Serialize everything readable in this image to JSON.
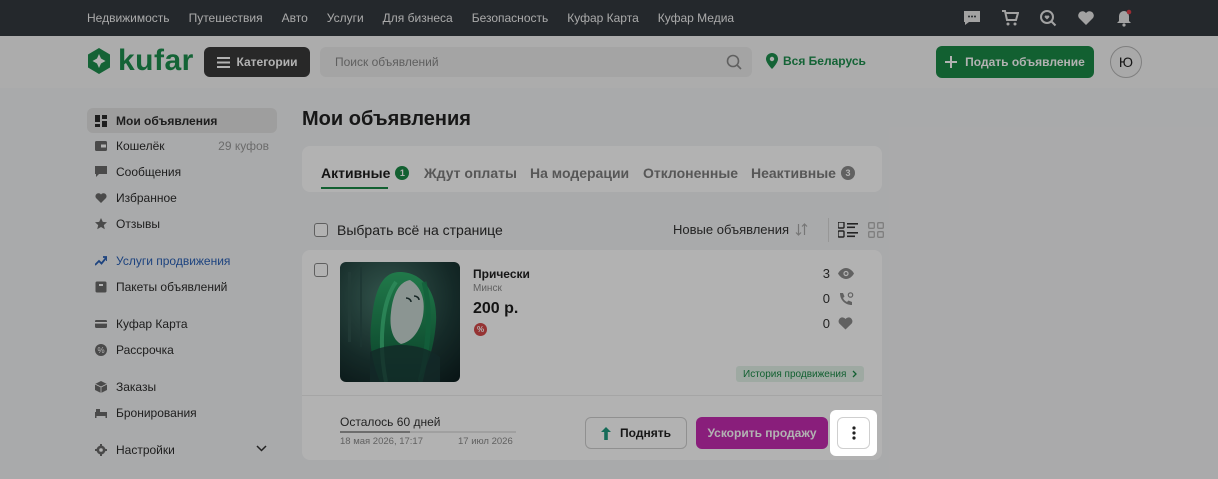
{
  "topnav": {
    "links": [
      "Недвижимость",
      "Путешествия",
      "Авто",
      "Услуги",
      "Для бизнеса",
      "Безопасность",
      "Куфар Карта",
      "Куфар Медиа"
    ],
    "icons": [
      "chat-icon",
      "cart-icon",
      "search-heart-icon",
      "heart-icon",
      "bell-icon"
    ]
  },
  "header": {
    "logo_text": "kufar",
    "categories_label": "Категории",
    "search_placeholder": "Поиск объявлений",
    "region_label": "Вся Беларусь",
    "post_label": "Подать объявление",
    "avatar_letter": "Ю"
  },
  "sidebar": {
    "items": [
      {
        "label": "Мои объявления",
        "icon": "dashboard-icon"
      },
      {
        "label": "Кошелёк",
        "extra": "29 куфов",
        "icon": "wallet-icon"
      },
      {
        "label": "Сообщения",
        "icon": "message-icon"
      },
      {
        "label": "Избранное",
        "icon": "heart-icon"
      },
      {
        "label": "Отзывы",
        "icon": "star-icon"
      },
      {
        "label": "Услуги продвижения",
        "icon": "trend-icon"
      },
      {
        "label": "Пакеты объявлений",
        "icon": "package-icon"
      },
      {
        "label": "Куфар Карта",
        "icon": "card-icon"
      },
      {
        "label": "Рассрочка",
        "icon": "installment-icon"
      },
      {
        "label": "Заказы",
        "icon": "box-icon"
      },
      {
        "label": "Бронирования",
        "icon": "bed-icon"
      },
      {
        "label": "Настройки",
        "icon": "gear-icon"
      }
    ]
  },
  "main": {
    "title": "Мои объявления",
    "tabs": [
      {
        "label": "Активные",
        "badge": "1"
      },
      {
        "label": "Ждут оплаты"
      },
      {
        "label": "На модерации"
      },
      {
        "label": "Отклоненные"
      },
      {
        "label": "Неактивные",
        "badge": "3"
      }
    ],
    "select_all_label": "Выбрать всё на странице",
    "sort_label": "Новые объявления"
  },
  "ad": {
    "title": "Прически",
    "city": "Минск",
    "price": "200 р.",
    "discount_symbol": "%",
    "views": "3",
    "calls": "0",
    "favorites": "0",
    "promo_history_label": "История продвижения",
    "remaining_label": "Осталось 60 дней",
    "remaining_progress": 0.4,
    "date_start": "18 мая 2026, 17:17",
    "date_end": "17 июл 2026",
    "raise_label": "Поднять",
    "boost_label": "Ускорить продажу"
  },
  "colors": {
    "brand_green": "#1b8a47",
    "boost_magenta": "#c42bb1",
    "topbar": "#343a40"
  }
}
